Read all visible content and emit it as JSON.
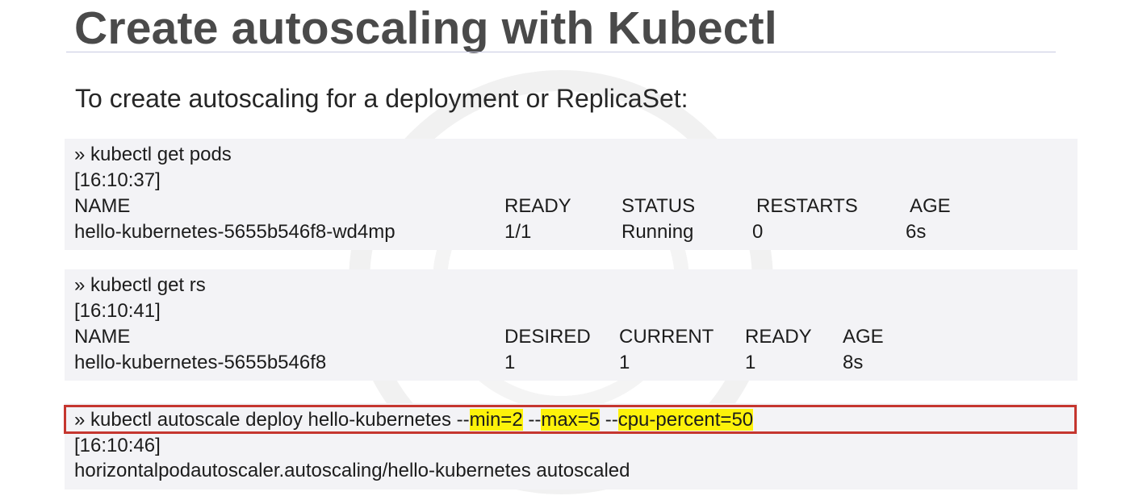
{
  "slide": {
    "title": "Create autoscaling with Kubectl",
    "intro": "To create autoscaling for a deployment or ReplicaSet:"
  },
  "pods_block": {
    "command": "» kubectl get pods",
    "timestamp": "[16:10:37]",
    "headers": [
      "NAME",
      "READY",
      "STATUS",
      "RESTARTS",
      "AGE"
    ],
    "row": [
      "hello-kubernetes-5655b546f8-wd4mp",
      "1/1",
      "Running",
      "0",
      "6s"
    ]
  },
  "rs_block": {
    "command": "» kubectl get rs",
    "timestamp": "[16:10:41]",
    "headers": [
      "NAME",
      "DESIRED",
      "CURRENT",
      "READY",
      "AGE"
    ],
    "row": [
      "hello-kubernetes-5655b546f8",
      "1",
      "1",
      "1",
      "8s"
    ]
  },
  "autoscale_block": {
    "command_prefix": "» kubectl autoscale deploy hello-kubernetes --",
    "min_flag": "min=2",
    "sep1": " --",
    "max_flag": "max=5",
    "sep2": " --",
    "cpu_flag": "cpu-percent=50",
    "timestamp": "[16:10:46]",
    "output": "horizontalpodautoscaler.autoscaling/hello-kubernetes autoscaled"
  },
  "colors": {
    "highlight": "#fdf20a",
    "box_border": "#c5362f",
    "block_background": "#f3f3f6",
    "title": "#4a4a4a"
  }
}
